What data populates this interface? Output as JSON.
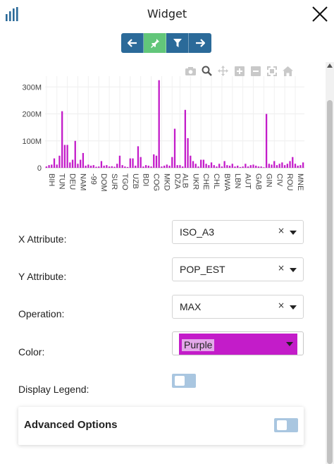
{
  "header": {
    "title": "Widget",
    "logo_icon": "bar-chart-icon",
    "close_icon": "close-icon"
  },
  "toolbar": {
    "buttons": [
      {
        "icon": "arrow-left-icon",
        "color": "#2b6a99"
      },
      {
        "icon": "pin-icon",
        "color": "#62c67a"
      },
      {
        "icon": "filter-icon",
        "color": "#2b6a99"
      },
      {
        "icon": "arrow-right-icon",
        "color": "#2b6a99"
      }
    ]
  },
  "modebar": [
    "camera-icon",
    "zoom-icon",
    "pan-icon",
    "zoom-in-icon",
    "zoom-out-icon",
    "autoscale-icon",
    "home-icon"
  ],
  "chart_data": {
    "type": "bar",
    "color": "#c31cc9",
    "ylim": [
      0,
      340
    ],
    "yticks": [
      "0",
      "100M",
      "200M",
      "300M"
    ],
    "ytick_values": [
      0,
      100,
      200,
      300
    ],
    "y_unit": "M",
    "tick_labels": [
      "BIH",
      "TUN",
      "DEU",
      "NAM",
      "-99",
      "DOM",
      "SUR",
      "TGO",
      "UZB",
      "BDI",
      "COG",
      "MKD",
      "DZA",
      "ALB",
      "UKR",
      "CHE",
      "CHL",
      "BWA",
      "LBN",
      "AUT",
      "GAB",
      "GIN",
      "CIV",
      "ROU",
      "MNE"
    ],
    "values": [
      5,
      10,
      12,
      35,
      12,
      45,
      210,
      85,
      85,
      20,
      30,
      100,
      15,
      30,
      55,
      8,
      12,
      8,
      10,
      4,
      5,
      25,
      8,
      10,
      5,
      6,
      4,
      15,
      45,
      10,
      5,
      3,
      35,
      35,
      8,
      80,
      40,
      5,
      10,
      8,
      5,
      50,
      45,
      325,
      5,
      8,
      12,
      8,
      40,
      145,
      10,
      10,
      5,
      215,
      110,
      45,
      25,
      15,
      5,
      30,
      30,
      15,
      10,
      20,
      10,
      5,
      15,
      5,
      25,
      10,
      8,
      15,
      5,
      8,
      3,
      5,
      15,
      5,
      10,
      12,
      8,
      5,
      5,
      2,
      200,
      15,
      12,
      25,
      10,
      15,
      20,
      10,
      15,
      25,
      40,
      15,
      8,
      10,
      20
    ]
  },
  "form": {
    "x_attribute": {
      "label": "X Attribute:",
      "value": "ISO_A3",
      "clear": "×"
    },
    "y_attribute": {
      "label": "Y Attribute:",
      "value": "POP_EST",
      "clear": "×"
    },
    "operation": {
      "label": "Operation:",
      "value": "MAX",
      "clear": "×"
    },
    "color": {
      "label": "Color:",
      "value": "Purple",
      "swatch": "#c31cc9",
      "chip": "#e3a8e9"
    },
    "display_legend": {
      "label": "Display Legend:",
      "on": false
    }
  },
  "advanced": {
    "title": "Advanced Options",
    "on": false
  },
  "colors": {
    "toolbar_blue": "#2b6a99",
    "toolbar_green": "#62c67a",
    "bar": "#c31cc9",
    "toggle_off": "#a9c6e0"
  }
}
